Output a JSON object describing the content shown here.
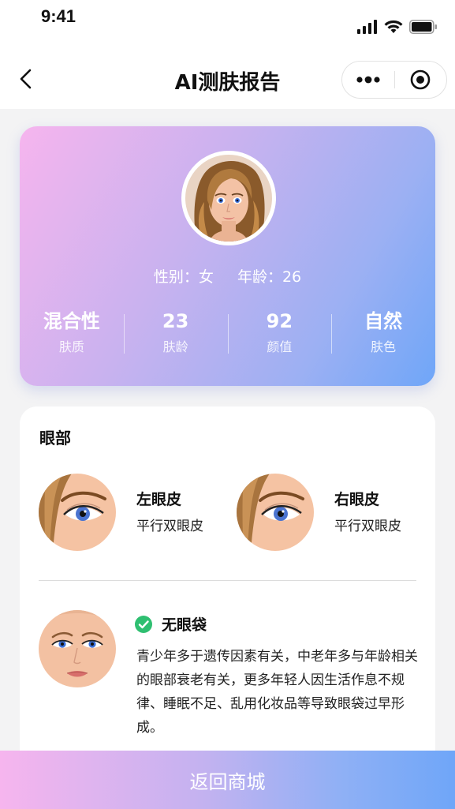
{
  "status_bar": {
    "time": "9:41"
  },
  "nav": {
    "title": "AI测肤报告"
  },
  "profile": {
    "gender": "性别：女",
    "age": "年龄：26",
    "stats": [
      {
        "value": "混合性",
        "label": "肤质"
      },
      {
        "value": "23",
        "label": "肤龄"
      },
      {
        "value": "92",
        "label": "颜值"
      },
      {
        "value": "自然",
        "label": "肤色"
      }
    ]
  },
  "eye_section": {
    "title": "眼部",
    "left_eyelid": {
      "name": "左眼皮",
      "desc": "平行双眼皮"
    },
    "right_eyelid": {
      "name": "右眼皮",
      "desc": "平行双眼皮"
    },
    "eye_bag": {
      "title": "无眼袋",
      "desc": "青少年多于遗传因素有关，中老年多与年龄相关的眼部衰老有关，更多年轻人因生活作息不规律、睡眠不足、乱用化妆品等导致眼袋过早形成。"
    }
  },
  "bottom_button": {
    "label": "返回商城"
  },
  "colors": {
    "gradient_start": "#f6b5ee",
    "gradient_end": "#6fa6f8",
    "check_green": "#2fbf71"
  }
}
